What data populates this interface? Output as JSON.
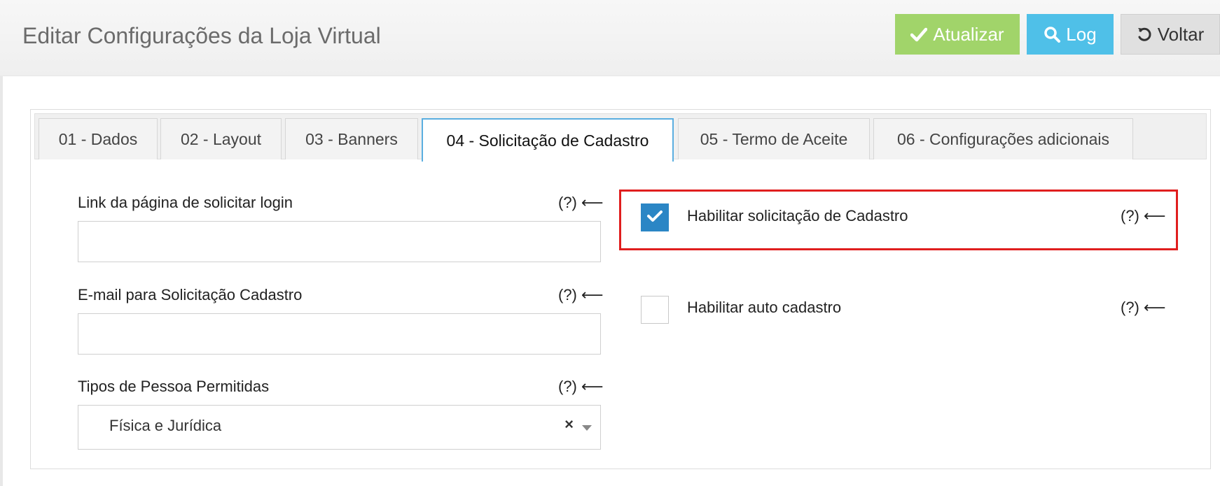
{
  "header": {
    "title": "Editar Configurações da Loja Virtual",
    "buttons": {
      "atualizar": "Atualizar",
      "log": "Log",
      "voltar": "Voltar"
    }
  },
  "tabs": [
    {
      "label": "01 - Dados"
    },
    {
      "label": "02 - Layout"
    },
    {
      "label": "03 - Banners"
    },
    {
      "label": "04 - Solicitação de Cadastro"
    },
    {
      "label": "05 - Termo de Aceite"
    },
    {
      "label": "06 - Configurações adicionais"
    }
  ],
  "active_tab": "04 - Solicitação de Cadastro",
  "help_text": "(?) ⟵",
  "form": {
    "link_login": {
      "label": "Link da página de solicitar login",
      "value": ""
    },
    "email": {
      "label": "E-mail para Solicitação Cadastro",
      "value": ""
    },
    "tipos_pessoa": {
      "label": "Tipos de Pessoa Permitidas",
      "value": "Física e Jurídica",
      "clear": "×"
    },
    "habilitar_solicitacao": {
      "label": "Habilitar solicitação de Cadastro",
      "checked": true
    },
    "habilitar_auto": {
      "label": "Habilitar auto cadastro",
      "checked": false
    }
  },
  "colors": {
    "atualizar": "#a1d46a",
    "log": "#4fc0e8",
    "checkbox_checked": "#2b86c5",
    "highlight": "#e01e1e",
    "active_tab_border": "#5aaee0"
  }
}
